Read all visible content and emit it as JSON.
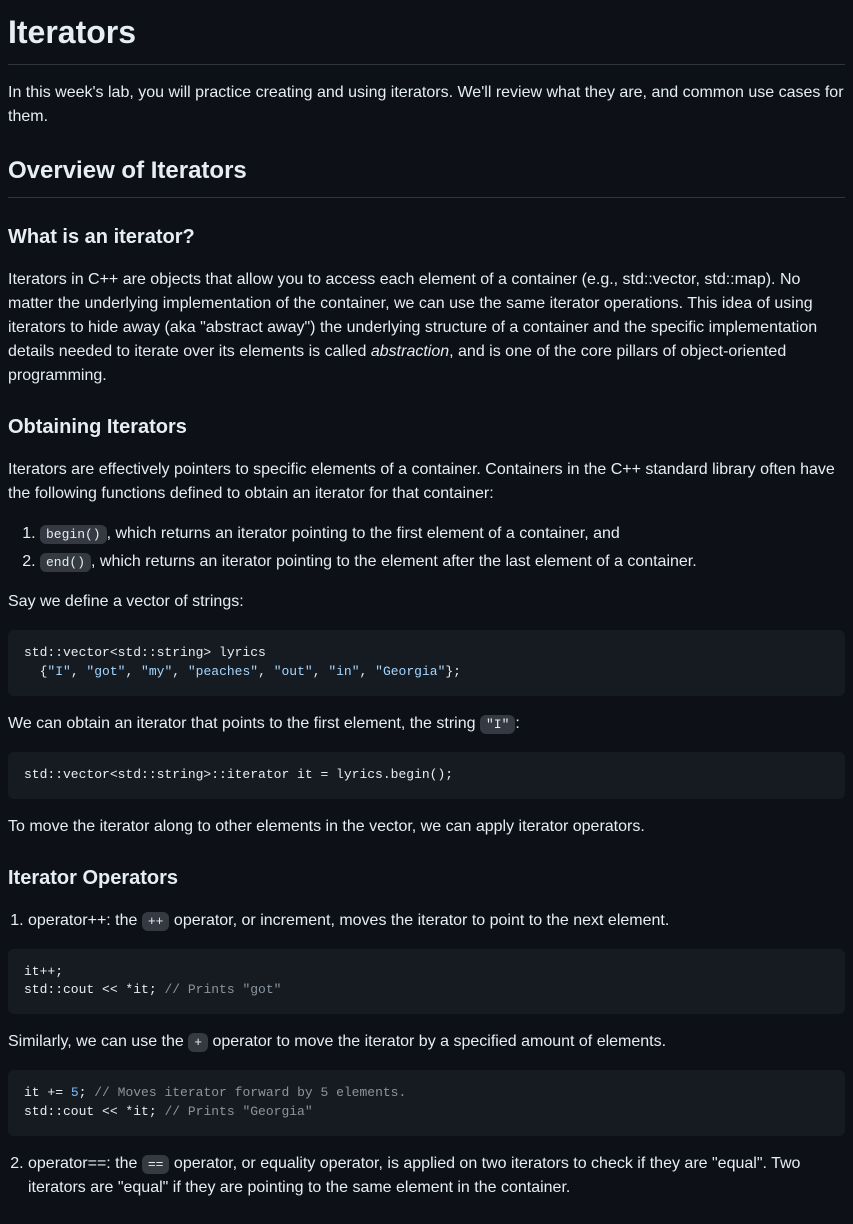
{
  "h1": "Iterators",
  "intro": "In this week's lab, you will practice creating and using iterators. We'll review what they are, and common use cases for them.",
  "h2_overview": "Overview of Iterators",
  "h3_what": "What is an iterator?",
  "p_what_1a": "Iterators in C++ are objects that allow you to access each element of a container (e.g., std::vector, std::map). No matter the underlying implementation of the container, we can use the same iterator operations. This idea of using iterators to hide away (aka \"abstract away\") the underlying structure of a container and the specific implementation details needed to iterate over its elements is called ",
  "p_what_1em": "abstraction",
  "p_what_1b": ", and is one of the core pillars of object-oriented programming.",
  "h3_obtain": "Obtaining Iterators",
  "p_obtain_1": "Iterators are effectively pointers to specific elements of a container. Containers in the C++ standard library often have the following functions defined to obtain an iterator for that container:",
  "li_begin_code": "begin()",
  "li_begin_text": ", which returns an iterator pointing to the first element of a container, and",
  "li_end_code": "end()",
  "li_end_text": ", which returns an iterator pointing to the element after the last element of a container.",
  "p_define": "Say we define a vector of strings:",
  "code1_l1": "std::vector<std::string> lyrics",
  "code1_l2a": "  {",
  "code1_s1": "\"I\"",
  "code1_c": ", ",
  "code1_s2": "\"got\"",
  "code1_s3": "\"my\"",
  "code1_s4": "\"peaches\"",
  "code1_s5": "\"out\"",
  "code1_s6": "\"in\"",
  "code1_s7": "\"Georgia\"",
  "code1_end": "};",
  "p_obtain_iter_a": "We can obtain an iterator that points to the first element, the string ",
  "p_obtain_iter_code": "\"I\"",
  "p_obtain_iter_b": ":",
  "code2": "std::vector<std::string>::iterator it = lyrics.begin();",
  "p_move": "To move the iterator along to other elements in the vector, we can apply iterator operators.",
  "h3_ops": "Iterator Operators",
  "op1_a": "operator++: the ",
  "op1_code": "++",
  "op1_b": " operator, or increment, moves the iterator to point to the next element.",
  "code3_l1": "it++;",
  "code3_l2a": "std::cout << *it; ",
  "code3_l2c": "// Prints \"got\"",
  "p_plus_a": "Similarly, we can use the ",
  "p_plus_code": "+",
  "p_plus_b": " operator to move the iterator by a specified amount of elements.",
  "code4_l1a": "it += ",
  "code4_l1n": "5",
  "code4_l1b": "; ",
  "code4_l1c": "// Moves iterator forward by 5 elements.",
  "code4_l2a": "std::cout << *it; ",
  "code4_l2c": "// Prints \"Georgia\"",
  "op2_a": "operator==: the ",
  "op2_code": "==",
  "op2_b": " operator, or equality operator, is applied on two iterators to check if they are \"equal\". Two iterators are \"equal\" if they are pointing to the same element in the container."
}
